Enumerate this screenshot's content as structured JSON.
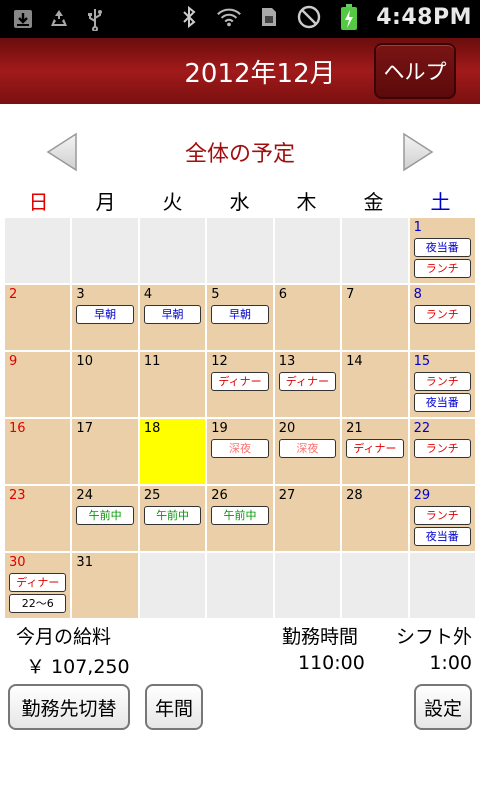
{
  "status_bar": {
    "time": "4:48PM",
    "left_icons": [
      "download-icon",
      "recycle-icon",
      "usb-icon"
    ],
    "right_icons": [
      "bluetooth-icon",
      "wifi-icon",
      "sim-icon",
      "no-signal-icon",
      "battery-charging-icon"
    ]
  },
  "header": {
    "title": "2012年12月",
    "help_label": "ヘルプ"
  },
  "nav": {
    "title": "全体の予定"
  },
  "weekdays": [
    "日",
    "月",
    "火",
    "水",
    "木",
    "金",
    "土"
  ],
  "calendar": {
    "weeks": [
      [
        {
          "day": ""
        },
        {
          "day": ""
        },
        {
          "day": ""
        },
        {
          "day": ""
        },
        {
          "day": ""
        },
        {
          "day": ""
        },
        {
          "day": "1",
          "shifts": [
            {
              "label": "夜当番",
              "color": "blue"
            },
            {
              "label": "ランチ",
              "color": "red"
            }
          ]
        }
      ],
      [
        {
          "day": "2"
        },
        {
          "day": "3",
          "shifts": [
            {
              "label": "早朝",
              "color": "blue"
            }
          ]
        },
        {
          "day": "4",
          "shifts": [
            {
              "label": "早朝",
              "color": "blue"
            }
          ]
        },
        {
          "day": "5",
          "shifts": [
            {
              "label": "早朝",
              "color": "blue"
            }
          ]
        },
        {
          "day": "6"
        },
        {
          "day": "7"
        },
        {
          "day": "8",
          "shifts": [
            {
              "label": "ランチ",
              "color": "red"
            }
          ]
        }
      ],
      [
        {
          "day": "9"
        },
        {
          "day": "10"
        },
        {
          "day": "11"
        },
        {
          "day": "12",
          "shifts": [
            {
              "label": "ディナー",
              "color": "red"
            }
          ]
        },
        {
          "day": "13",
          "shifts": [
            {
              "label": "ディナー",
              "color": "red"
            }
          ]
        },
        {
          "day": "14"
        },
        {
          "day": "15",
          "shifts": [
            {
              "label": "ランチ",
              "color": "red"
            },
            {
              "label": "夜当番",
              "color": "blue"
            }
          ]
        }
      ],
      [
        {
          "day": "16"
        },
        {
          "day": "17"
        },
        {
          "day": "18",
          "today": true
        },
        {
          "day": "19",
          "shifts": [
            {
              "label": "深夜",
              "color": "pink"
            }
          ]
        },
        {
          "day": "20",
          "shifts": [
            {
              "label": "深夜",
              "color": "pink"
            }
          ]
        },
        {
          "day": "21",
          "shifts": [
            {
              "label": "ディナー",
              "color": "red"
            }
          ]
        },
        {
          "day": "22",
          "shifts": [
            {
              "label": "ランチ",
              "color": "red"
            }
          ]
        }
      ],
      [
        {
          "day": "23"
        },
        {
          "day": "24",
          "shifts": [
            {
              "label": "午前中",
              "color": "green"
            }
          ]
        },
        {
          "day": "25",
          "shifts": [
            {
              "label": "午前中",
              "color": "green"
            }
          ]
        },
        {
          "day": "26",
          "shifts": [
            {
              "label": "午前中",
              "color": "green"
            }
          ]
        },
        {
          "day": "27"
        },
        {
          "day": "28"
        },
        {
          "day": "29",
          "shifts": [
            {
              "label": "ランチ",
              "color": "red"
            },
            {
              "label": "夜当番",
              "color": "blue"
            }
          ]
        }
      ],
      [
        {
          "day": "30",
          "shifts": [
            {
              "label": "ディナー",
              "color": "red"
            },
            {
              "label": "22～6",
              "color": "black"
            }
          ]
        },
        {
          "day": "31"
        },
        {
          "day": ""
        },
        {
          "day": ""
        },
        {
          "day": ""
        },
        {
          "day": ""
        },
        {
          "day": ""
        }
      ]
    ]
  },
  "summary": {
    "salary_label": "今月の給料",
    "salary_value": "￥ 107,250",
    "hours_label": "勤務時間",
    "hours_value": "110:00",
    "off_shift_label": "シフト外",
    "off_shift_value": "1:00"
  },
  "buttons": {
    "workplace_switch": "勤務先切替",
    "yearly": "年間",
    "settings": "設定"
  }
}
